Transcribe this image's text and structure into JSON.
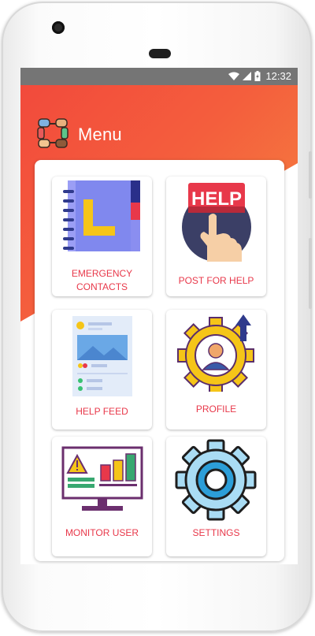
{
  "status_bar": {
    "time": "12:32"
  },
  "app": {
    "title": "Menu"
  },
  "menu": {
    "items": [
      {
        "label": "EMERGENCY\nCONTACTS",
        "icon": "contacts-book-icon"
      },
      {
        "label": "POST FOR HELP",
        "icon": "help-button-icon"
      },
      {
        "label": "HELP FEED",
        "icon": "feed-icon"
      },
      {
        "label": "PROFILE",
        "icon": "profile-gear-icon"
      },
      {
        "label": "MONITOR USER",
        "icon": "monitor-icon"
      },
      {
        "label": "SETTINGS",
        "icon": "settings-gear-icon"
      }
    ]
  },
  "icons": {
    "help_text": "HELP"
  },
  "colors": {
    "accent": "#e8384a",
    "header_start": "#f24a3c",
    "header_end": "#f6893f"
  }
}
